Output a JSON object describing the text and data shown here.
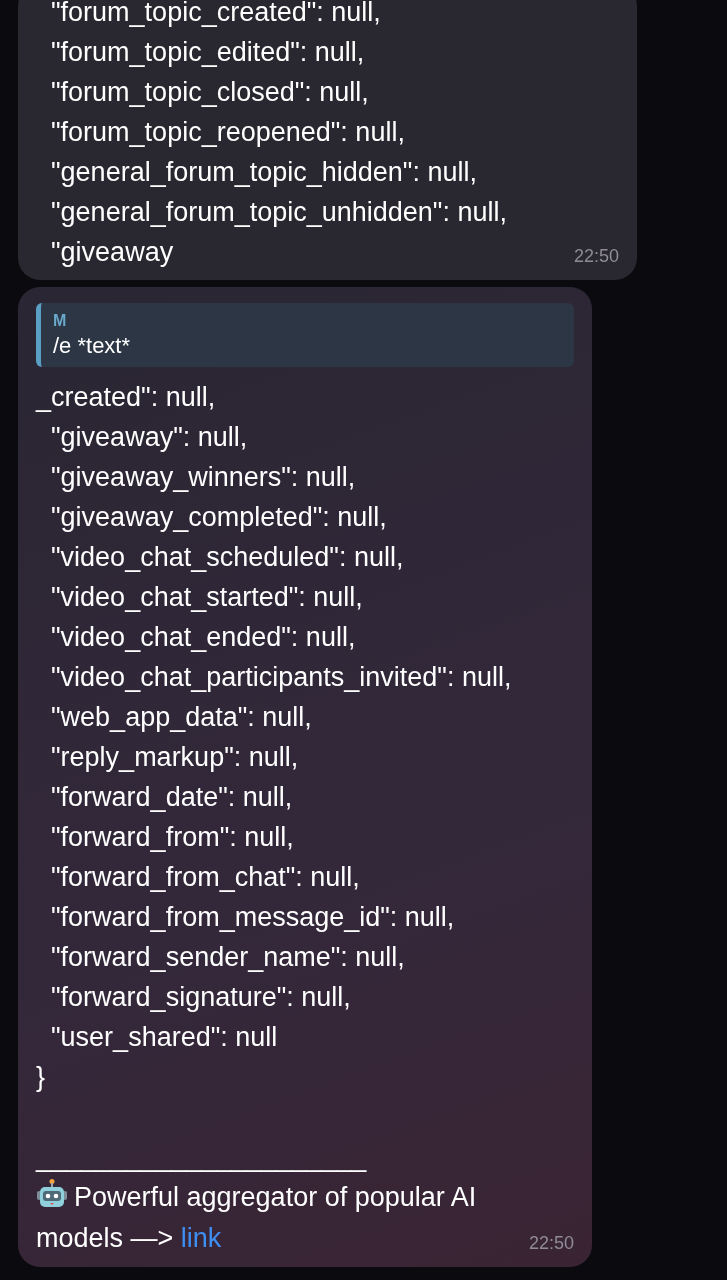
{
  "messages": [
    {
      "lines": [
        "  \"forum_topic_created\": null,",
        "  \"forum_topic_edited\": null,",
        "  \"forum_topic_closed\": null,",
        "  \"forum_topic_reopened\": null,",
        "  \"general_forum_topic_hidden\": null,",
        "  \"general_forum_topic_unhidden\": null,",
        "  \"giveaway"
      ],
      "time": "22:50"
    },
    {
      "reply": {
        "author": "M",
        "text": "/e *text*"
      },
      "lines": [
        "_created\": null,",
        "  \"giveaway\": null,",
        "  \"giveaway_winners\": null,",
        "  \"giveaway_completed\": null,",
        "  \"video_chat_scheduled\": null,",
        "  \"video_chat_started\": null,",
        "  \"video_chat_ended\": null,",
        "  \"video_chat_participants_invited\": null,",
        "  \"web_app_data\": null,",
        "  \"reply_markup\": null,",
        "  \"forward_date\": null,",
        "  \"forward_from\": null,",
        "  \"forward_from_chat\": null,",
        "  \"forward_from_message_id\": null,",
        "  \"forward_sender_name\": null,",
        "  \"forward_signature\": null,",
        "  \"user_shared\": null",
        "}"
      ],
      "separator": "______________________",
      "footer": {
        "text": "Powerful aggregator of popular AI models —>",
        "link": "link"
      },
      "time": "22:50"
    }
  ]
}
